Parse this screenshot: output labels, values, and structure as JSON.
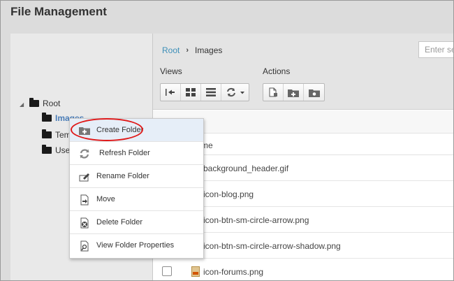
{
  "app": {
    "title": "File Management"
  },
  "tree": {
    "root_label": "Root",
    "children": [
      {
        "label": "Images",
        "visible_text": "Images",
        "selected": true
      },
      {
        "label": "Templates",
        "visible_text": "Tem"
      },
      {
        "label": "Users",
        "visible_text": "Use"
      }
    ]
  },
  "breadcrumb": {
    "root": "Root",
    "separator": "›",
    "current": "Images"
  },
  "search": {
    "placeholder": "Enter search"
  },
  "views": {
    "label": "Views",
    "buttons": [
      "collapse-panel-icon",
      "grid-view-icon",
      "list-view-icon",
      "refresh-dropdown-icon"
    ]
  },
  "actions": {
    "label": "Actions",
    "buttons": [
      "upload-file-icon",
      "new-folder-icon",
      "folder-properties-icon"
    ]
  },
  "file_list": {
    "column_header": "Name",
    "column_header_visible": "me",
    "files": [
      {
        "name": "background_header.gif",
        "visible": "background_header.gif"
      },
      {
        "name": "icon-blog.png",
        "visible": "icon-blog.png"
      },
      {
        "name": "icon-btn-sm-circle-arrow.png",
        "visible": "icon-btn-sm-circle-arrow.png"
      },
      {
        "name": "icon-btn-sm-circle-arrow-shadow.png",
        "visible": "icon-btn-sm-circle-arrow-shadow.png"
      },
      {
        "name": "icon-forums.png",
        "visible": "icon-forums.png"
      }
    ]
  },
  "context_menu": {
    "items": [
      {
        "label": "Create Folder",
        "icon": "create-folder-icon"
      },
      {
        "label": "Refresh Folder",
        "icon": "refresh-icon"
      },
      {
        "label": "Rename Folder",
        "icon": "rename-icon"
      },
      {
        "label": "Move",
        "icon": "move-icon"
      },
      {
        "label": "Delete Folder",
        "icon": "delete-icon"
      },
      {
        "label": "View Folder Properties",
        "icon": "properties-icon"
      }
    ]
  },
  "colors": {
    "link": "#3d8fb8",
    "highlight": "#e01a1a",
    "selected_text": "#4a7db8"
  }
}
